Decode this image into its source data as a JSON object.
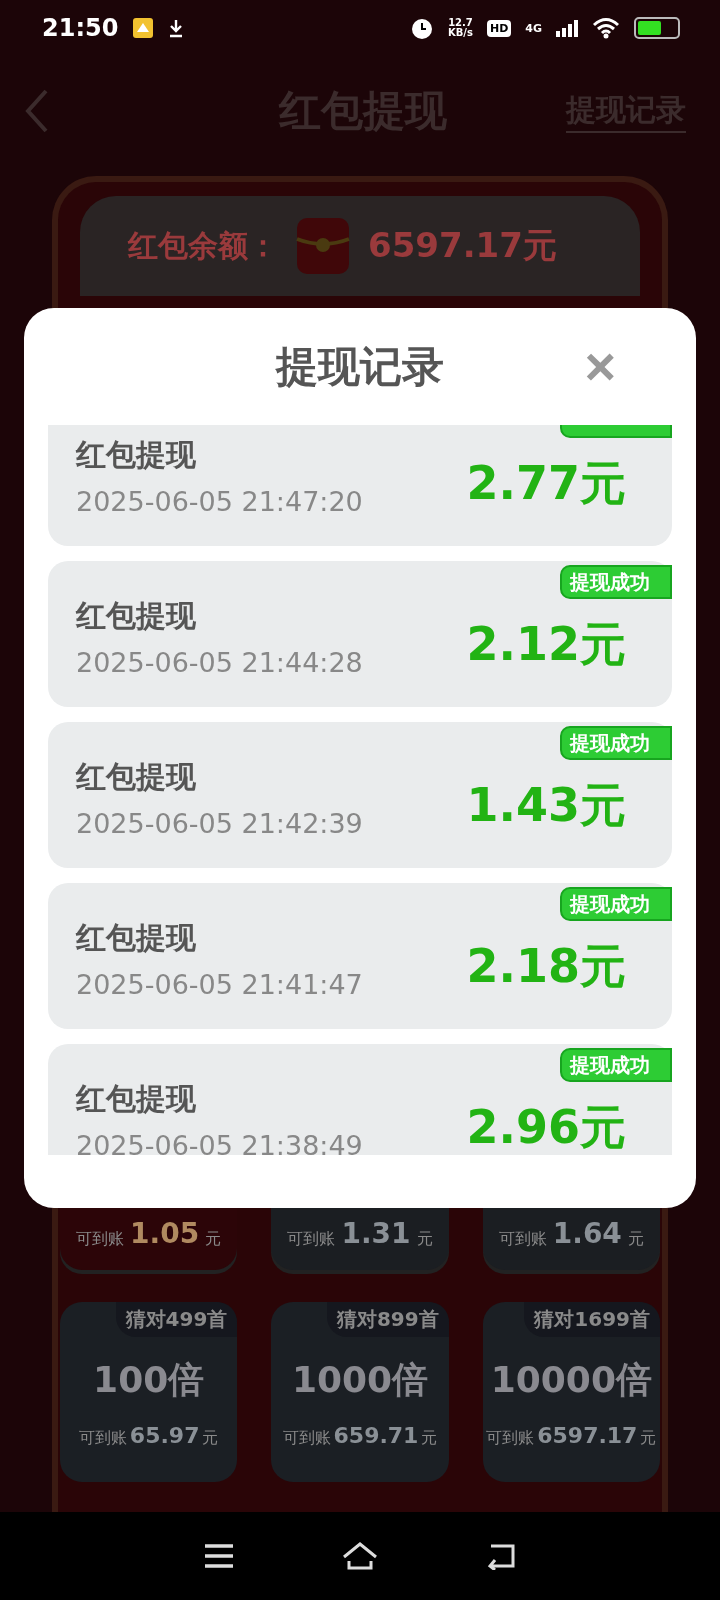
{
  "status_bar": {
    "time": "21:50",
    "net_speed": "12.7",
    "net_unit": "KB/s",
    "hd": "HD",
    "network": "4G",
    "battery": {
      "level": 0.6
    }
  },
  "header": {
    "title": "红包提现",
    "link": "提现记录"
  },
  "balance": {
    "label": "红包余额：",
    "amount": "6597.17元"
  },
  "reward_cards": [
    {
      "selected": true,
      "prefix": "可到账",
      "amount": "1.05",
      "unit": "元"
    },
    {
      "selected": false,
      "prefix": "可到账",
      "amount": "1.31",
      "unit": "元"
    },
    {
      "selected": false,
      "prefix": "可到账",
      "amount": "1.64",
      "unit": "元"
    }
  ],
  "multiplier_cards": [
    {
      "tag": "猜对499首",
      "multiple": "100倍",
      "prefix": "可到账",
      "amount": "65.97",
      "unit": "元"
    },
    {
      "tag": "猜对899首",
      "multiple": "1000倍",
      "prefix": "可到账",
      "amount": "659.71",
      "unit": "元"
    },
    {
      "tag": "猜对1699首",
      "multiple": "10000倍",
      "prefix": "可到账",
      "amount": "6597.17",
      "unit": "元"
    }
  ],
  "dialog": {
    "title": "提现记录",
    "close": "×",
    "records": [
      {
        "kind": "clipped",
        "title": "红包提现",
        "time": "2025-06-05 21:47:20",
        "amount": "2.77元"
      },
      {
        "kind": "full",
        "title": "红包提现",
        "time": "2025-06-05 21:44:28",
        "amount": "2.12元",
        "status": "提现成功"
      },
      {
        "kind": "full",
        "title": "红包提现",
        "time": "2025-06-05 21:42:39",
        "amount": "1.43元",
        "status": "提现成功"
      },
      {
        "kind": "full",
        "title": "红包提现",
        "time": "2025-06-05 21:41:47",
        "amount": "2.18元",
        "status": "提现成功"
      },
      {
        "kind": "full",
        "title": "红包提现",
        "time": "2025-06-05 21:38:49",
        "amount": "2.96元",
        "status": "提现成功"
      }
    ]
  }
}
